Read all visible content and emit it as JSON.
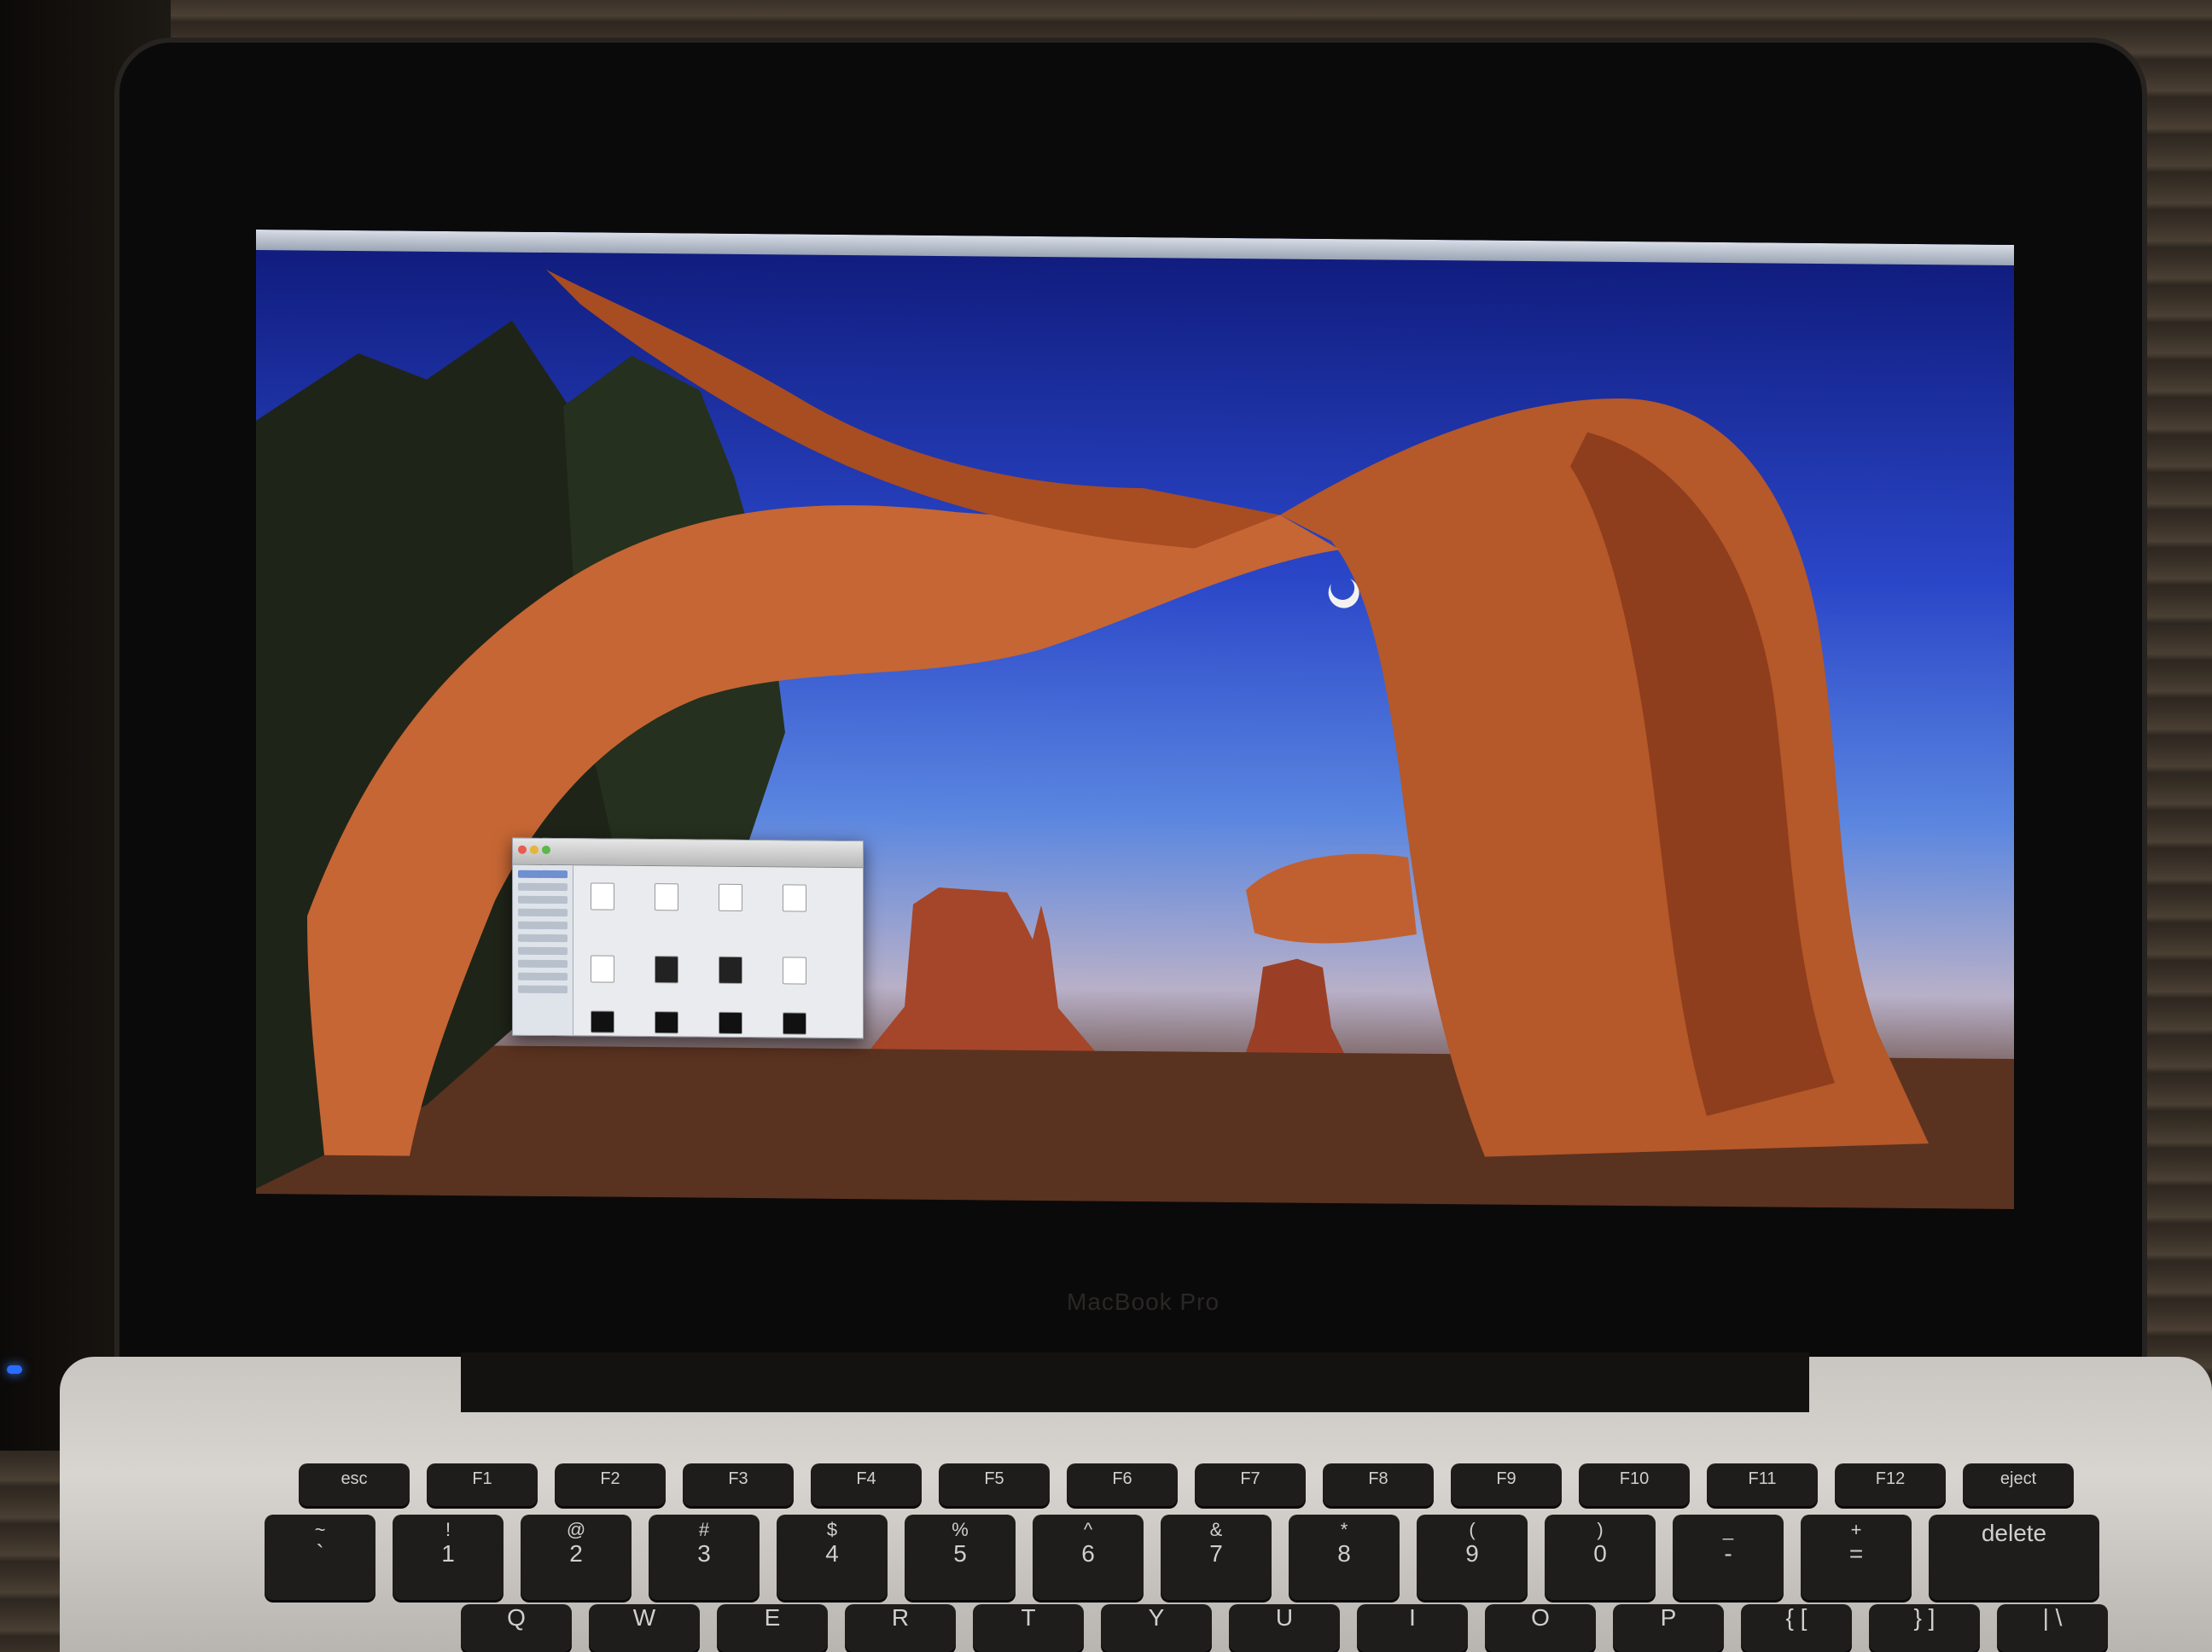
{
  "menubar": {
    "app_text": ""
  },
  "bezel": {
    "logo": "MacBook Pro"
  },
  "finder": {
    "title": ""
  },
  "keyboard": {
    "fn_row": [
      "esc",
      "F1",
      "F2",
      "F3",
      "F4",
      "F5",
      "F6",
      "F7",
      "F8",
      "F9",
      "F10",
      "F11",
      "F12",
      "eject"
    ],
    "number_row": [
      {
        "top": "~",
        "bot": "`"
      },
      {
        "top": "!",
        "bot": "1"
      },
      {
        "top": "@",
        "bot": "2"
      },
      {
        "top": "#",
        "bot": "3"
      },
      {
        "top": "$",
        "bot": "4"
      },
      {
        "top": "%",
        "bot": "5"
      },
      {
        "top": "^",
        "bot": "6"
      },
      {
        "top": "&",
        "bot": "7"
      },
      {
        "top": "*",
        "bot": "8"
      },
      {
        "top": "(",
        "bot": "9"
      },
      {
        "top": ")",
        "bot": "0"
      },
      {
        "top": "_",
        "bot": "-"
      },
      {
        "top": "+",
        "bot": "="
      },
      {
        "top": "",
        "bot": "delete"
      }
    ],
    "qwerty_row": [
      "Q",
      "W",
      "E",
      "R",
      "T",
      "Y",
      "U",
      "I",
      "O",
      "P",
      "{ [",
      "} ]",
      "| \\"
    ]
  },
  "colors": {
    "sky_top": "#0f1a7a",
    "sky_mid": "#2a46c8",
    "tree_bark": "#b5582a",
    "keyboard_keys": "#1f1d1c",
    "aluminum": "#c9c6c2"
  }
}
